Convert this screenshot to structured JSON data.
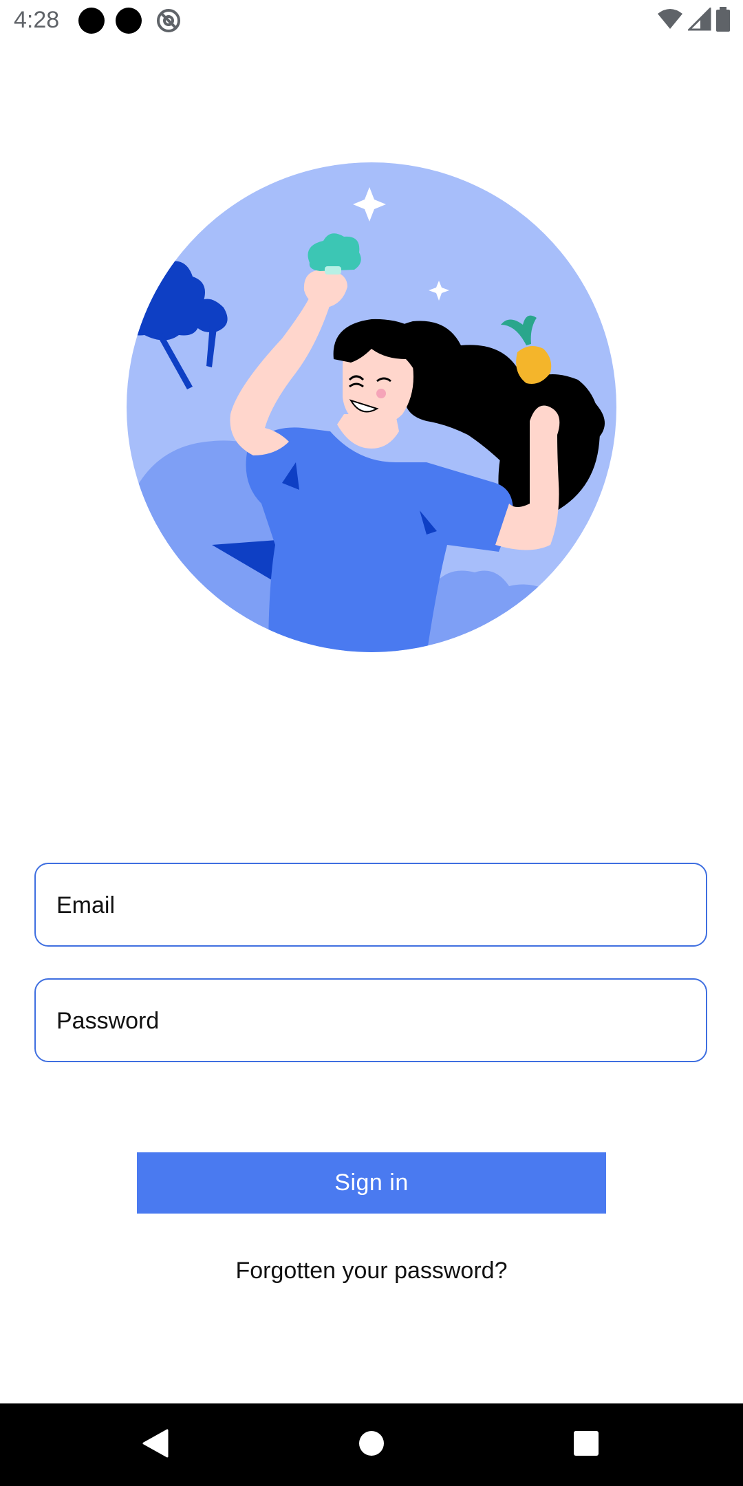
{
  "status_bar": {
    "time": "4:28",
    "icons": [
      "notification-dot-icon",
      "notification-dot-icon",
      "sync-icon",
      "wifi-icon",
      "cell-signal-icon",
      "battery-icon"
    ]
  },
  "hero": {
    "illustration": "woman-with-vegetables-illustration",
    "colors": {
      "circle": "#a7befa",
      "shirt": "#4a7af0",
      "dark_blue": "#0e3fc4",
      "hair": "#000000",
      "skin": "#ffd6cc",
      "carrot": "#f4b52b",
      "greens": "#3cc6b4"
    }
  },
  "form": {
    "email": {
      "placeholder": "Email",
      "value": ""
    },
    "password": {
      "placeholder": "Password",
      "value": ""
    },
    "sign_in_label": "Sign in",
    "forgot_label": "Forgotten your password?"
  },
  "nav_bar": {
    "icons": [
      "back-icon",
      "home-icon",
      "recents-icon"
    ]
  },
  "colors": {
    "accent": "#4a7af0",
    "field_border": "#3f6fe0",
    "background": "#ffffff",
    "nav_background": "#000000"
  }
}
